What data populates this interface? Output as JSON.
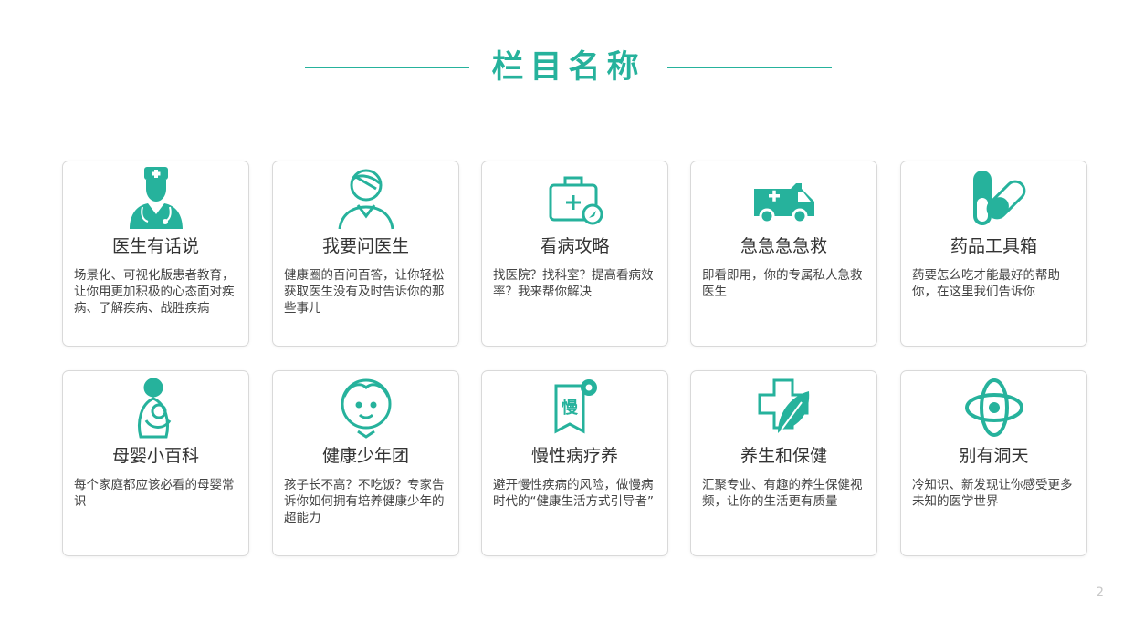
{
  "header": {
    "title": "栏目名称"
  },
  "colors": {
    "accent": "#26b29c",
    "card_border": "#d9d9d9",
    "text": "#333333"
  },
  "cards": [
    {
      "title": "医生有话说",
      "desc": "场景化、可视化版患者教育，让你用更加积极的心态面对疾病、了解疾病、战胜疾病",
      "icon": "doctor-icon"
    },
    {
      "title": "我要问医生",
      "desc": "健康圈的百问百答，让你轻松获取医生没有及时告诉你的那些事儿",
      "icon": "patient-icon"
    },
    {
      "title": "看病攻略",
      "desc": "找医院？找科室？提高看病效率？我来帮你解决",
      "icon": "medical-kit-icon"
    },
    {
      "title": "急急急急救",
      "desc": "即看即用，你的专属私人急救医生",
      "icon": "ambulance-icon"
    },
    {
      "title": "药品工具箱",
      "desc": "药要怎么吃才能最好的帮助你，在这里我们告诉你",
      "icon": "pills-icon"
    },
    {
      "title": "母婴小百科",
      "desc": "每个家庭都应该必看的母婴常识",
      "icon": "mother-baby-icon"
    },
    {
      "title": "健康少年团",
      "desc": "孩子长不高？不吃饭？专家告诉你如何拥有培养健康少年的超能力",
      "icon": "child-icon"
    },
    {
      "title": "慢性病疗养",
      "desc": "避开慢性疾病的风险，做慢病时代的“健康生活方式引导者”",
      "icon": "chronic-book-icon",
      "icon_glyph": "慢"
    },
    {
      "title": "养生和保健",
      "desc": "汇聚专业、有趣的养生保健视频，让你的生活更有质量",
      "icon": "leaf-cross-icon"
    },
    {
      "title": "别有洞天",
      "desc": "冷知识、新发现让你感受更多未知的医学世界",
      "icon": "atom-icon"
    }
  ],
  "footer": {
    "page_number": "2"
  }
}
